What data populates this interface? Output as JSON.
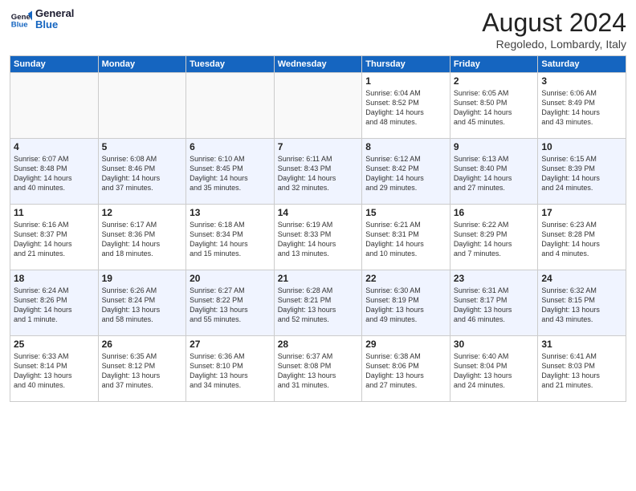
{
  "header": {
    "logo_line1": "General",
    "logo_line2": "Blue",
    "month": "August 2024",
    "location": "Regoledo, Lombardy, Italy"
  },
  "weekdays": [
    "Sunday",
    "Monday",
    "Tuesday",
    "Wednesday",
    "Thursday",
    "Friday",
    "Saturday"
  ],
  "weeks": [
    [
      {
        "day": "",
        "info": ""
      },
      {
        "day": "",
        "info": ""
      },
      {
        "day": "",
        "info": ""
      },
      {
        "day": "",
        "info": ""
      },
      {
        "day": "1",
        "info": "Sunrise: 6:04 AM\nSunset: 8:52 PM\nDaylight: 14 hours\nand 48 minutes."
      },
      {
        "day": "2",
        "info": "Sunrise: 6:05 AM\nSunset: 8:50 PM\nDaylight: 14 hours\nand 45 minutes."
      },
      {
        "day": "3",
        "info": "Sunrise: 6:06 AM\nSunset: 8:49 PM\nDaylight: 14 hours\nand 43 minutes."
      }
    ],
    [
      {
        "day": "4",
        "info": "Sunrise: 6:07 AM\nSunset: 8:48 PM\nDaylight: 14 hours\nand 40 minutes."
      },
      {
        "day": "5",
        "info": "Sunrise: 6:08 AM\nSunset: 8:46 PM\nDaylight: 14 hours\nand 37 minutes."
      },
      {
        "day": "6",
        "info": "Sunrise: 6:10 AM\nSunset: 8:45 PM\nDaylight: 14 hours\nand 35 minutes."
      },
      {
        "day": "7",
        "info": "Sunrise: 6:11 AM\nSunset: 8:43 PM\nDaylight: 14 hours\nand 32 minutes."
      },
      {
        "day": "8",
        "info": "Sunrise: 6:12 AM\nSunset: 8:42 PM\nDaylight: 14 hours\nand 29 minutes."
      },
      {
        "day": "9",
        "info": "Sunrise: 6:13 AM\nSunset: 8:40 PM\nDaylight: 14 hours\nand 27 minutes."
      },
      {
        "day": "10",
        "info": "Sunrise: 6:15 AM\nSunset: 8:39 PM\nDaylight: 14 hours\nand 24 minutes."
      }
    ],
    [
      {
        "day": "11",
        "info": "Sunrise: 6:16 AM\nSunset: 8:37 PM\nDaylight: 14 hours\nand 21 minutes."
      },
      {
        "day": "12",
        "info": "Sunrise: 6:17 AM\nSunset: 8:36 PM\nDaylight: 14 hours\nand 18 minutes."
      },
      {
        "day": "13",
        "info": "Sunrise: 6:18 AM\nSunset: 8:34 PM\nDaylight: 14 hours\nand 15 minutes."
      },
      {
        "day": "14",
        "info": "Sunrise: 6:19 AM\nSunset: 8:33 PM\nDaylight: 14 hours\nand 13 minutes."
      },
      {
        "day": "15",
        "info": "Sunrise: 6:21 AM\nSunset: 8:31 PM\nDaylight: 14 hours\nand 10 minutes."
      },
      {
        "day": "16",
        "info": "Sunrise: 6:22 AM\nSunset: 8:29 PM\nDaylight: 14 hours\nand 7 minutes."
      },
      {
        "day": "17",
        "info": "Sunrise: 6:23 AM\nSunset: 8:28 PM\nDaylight: 14 hours\nand 4 minutes."
      }
    ],
    [
      {
        "day": "18",
        "info": "Sunrise: 6:24 AM\nSunset: 8:26 PM\nDaylight: 14 hours\nand 1 minute."
      },
      {
        "day": "19",
        "info": "Sunrise: 6:26 AM\nSunset: 8:24 PM\nDaylight: 13 hours\nand 58 minutes."
      },
      {
        "day": "20",
        "info": "Sunrise: 6:27 AM\nSunset: 8:22 PM\nDaylight: 13 hours\nand 55 minutes."
      },
      {
        "day": "21",
        "info": "Sunrise: 6:28 AM\nSunset: 8:21 PM\nDaylight: 13 hours\nand 52 minutes."
      },
      {
        "day": "22",
        "info": "Sunrise: 6:30 AM\nSunset: 8:19 PM\nDaylight: 13 hours\nand 49 minutes."
      },
      {
        "day": "23",
        "info": "Sunrise: 6:31 AM\nSunset: 8:17 PM\nDaylight: 13 hours\nand 46 minutes."
      },
      {
        "day": "24",
        "info": "Sunrise: 6:32 AM\nSunset: 8:15 PM\nDaylight: 13 hours\nand 43 minutes."
      }
    ],
    [
      {
        "day": "25",
        "info": "Sunrise: 6:33 AM\nSunset: 8:14 PM\nDaylight: 13 hours\nand 40 minutes."
      },
      {
        "day": "26",
        "info": "Sunrise: 6:35 AM\nSunset: 8:12 PM\nDaylight: 13 hours\nand 37 minutes."
      },
      {
        "day": "27",
        "info": "Sunrise: 6:36 AM\nSunset: 8:10 PM\nDaylight: 13 hours\nand 34 minutes."
      },
      {
        "day": "28",
        "info": "Sunrise: 6:37 AM\nSunset: 8:08 PM\nDaylight: 13 hours\nand 31 minutes."
      },
      {
        "day": "29",
        "info": "Sunrise: 6:38 AM\nSunset: 8:06 PM\nDaylight: 13 hours\nand 27 minutes."
      },
      {
        "day": "30",
        "info": "Sunrise: 6:40 AM\nSunset: 8:04 PM\nDaylight: 13 hours\nand 24 minutes."
      },
      {
        "day": "31",
        "info": "Sunrise: 6:41 AM\nSunset: 8:03 PM\nDaylight: 13 hours\nand 21 minutes."
      }
    ]
  ]
}
